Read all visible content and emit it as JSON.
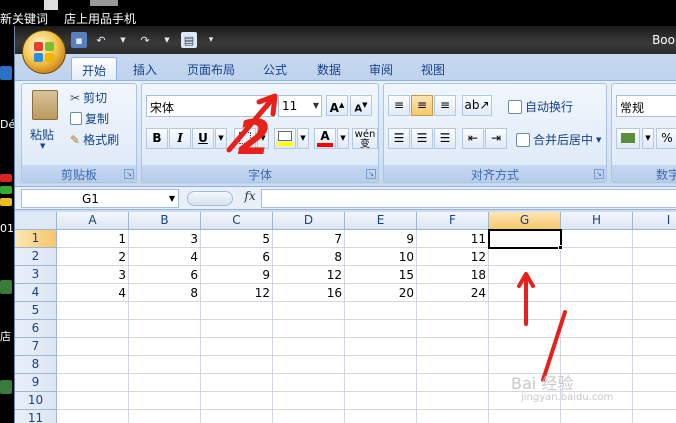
{
  "desktop": {
    "top_labels": [
      "新关键词",
      "店上用品手机"
    ],
    "left_labels": [
      "Dé",
      "01",
      "店"
    ]
  },
  "window": {
    "title": "Boo",
    "qat_icons": [
      "save-icon",
      "undo-icon",
      "redo-icon",
      "print-preview-icon",
      "customize-icon"
    ]
  },
  "ribbon": {
    "tabs": [
      "开始",
      "插入",
      "页面布局",
      "公式",
      "数据",
      "审阅",
      "视图"
    ],
    "active_tab": "开始",
    "clipboard": {
      "paste": "粘贴",
      "cut": "剪切",
      "copy": "复制",
      "format_painter": "格式刷",
      "label": "剪贴板"
    },
    "font": {
      "name": "宋体",
      "size": "11",
      "bold": "B",
      "italic": "I",
      "underline": "U",
      "font_color": "A",
      "phonetic": "wén 变",
      "label": "字体"
    },
    "alignment": {
      "wrap": "自动换行",
      "merge": "合并后居中",
      "label": "对齐方式"
    },
    "number": {
      "format": "常规",
      "percent": "%",
      "label": "数字"
    }
  },
  "formula_bar": {
    "name_box": "G1",
    "fx": "fx",
    "formula": ""
  },
  "sheet": {
    "columns": [
      "A",
      "B",
      "C",
      "D",
      "E",
      "F",
      "G",
      "H",
      "I"
    ],
    "selected_column": "G",
    "rows": [
      "1",
      "2",
      "3",
      "4",
      "5",
      "6",
      "7",
      "8",
      "9",
      "10",
      "11"
    ],
    "selected_row": "1",
    "active_cell": "G1",
    "data": [
      [
        "1",
        "3",
        "5",
        "7",
        "9",
        "11"
      ],
      [
        "2",
        "4",
        "6",
        "8",
        "10",
        "12"
      ],
      [
        "3",
        "6",
        "9",
        "12",
        "15",
        "18"
      ],
      [
        "4",
        "8",
        "12",
        "16",
        "20",
        "24"
      ]
    ]
  },
  "annotations": {
    "number_label": "2",
    "color": "#e8201a"
  },
  "watermark": {
    "brand": "Bai 经验",
    "url": "jingyan.baidu.com"
  }
}
